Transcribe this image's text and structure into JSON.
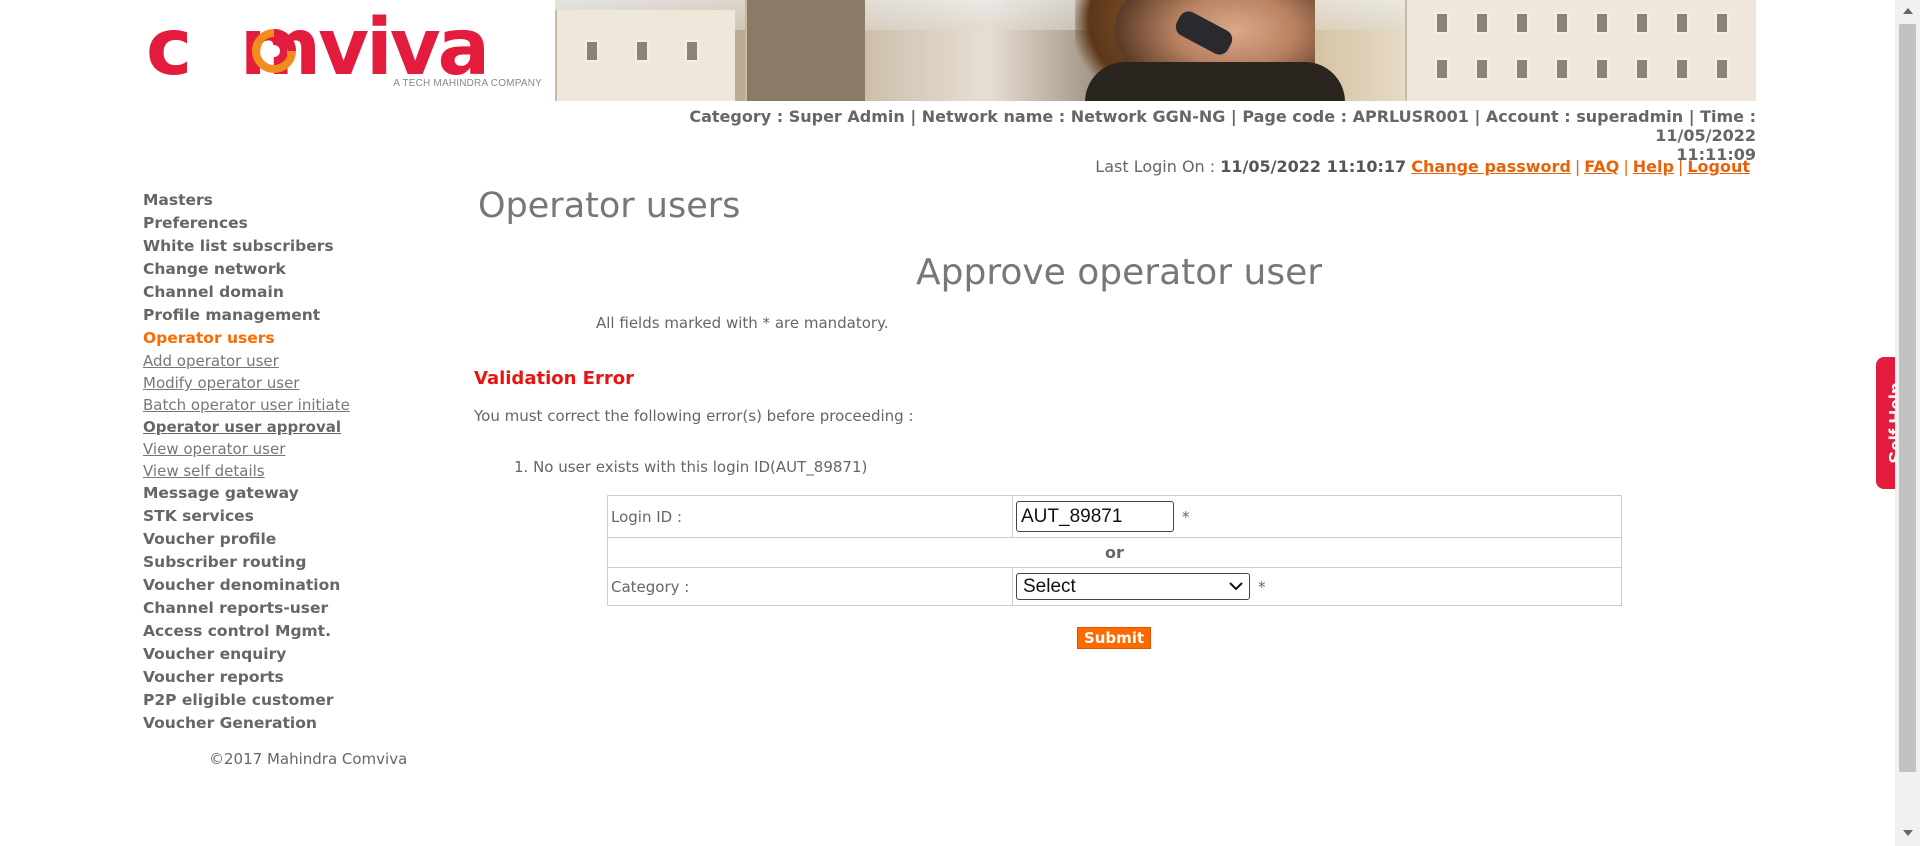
{
  "brand": {
    "name": "comviva",
    "tagline": "A TECH MAHINDRA COMPANY",
    "primary_color": "#e31b3c",
    "accent_color": "#ff6a00"
  },
  "info": {
    "line1": "Category : Super Admin | Network name : Network GGN-NG | Page code : APRLUSR001 | Account : superadmin | Time : 11/05/2022",
    "line2": "11:11:09"
  },
  "login": {
    "prefix": "Last Login On :",
    "timestamp": "11/05/2022 11:10:17",
    "change_password": "Change password",
    "faq": "FAQ",
    "help": "Help",
    "logout": "Logout"
  },
  "sidebar": {
    "items": [
      {
        "label": "Masters"
      },
      {
        "label": "Preferences"
      },
      {
        "label": "White list subscribers"
      },
      {
        "label": "Change network"
      },
      {
        "label": "Channel domain"
      },
      {
        "label": "Profile management"
      },
      {
        "label": "Operator users"
      },
      {
        "label": "Message gateway"
      },
      {
        "label": "STK services"
      },
      {
        "label": "Voucher profile"
      },
      {
        "label": "Subscriber routing"
      },
      {
        "label": "Voucher denomination"
      },
      {
        "label": "Channel reports-user"
      },
      {
        "label": "Access control Mgmt."
      },
      {
        "label": "Voucher enquiry"
      },
      {
        "label": "Voucher reports"
      },
      {
        "label": "P2P eligible customer"
      },
      {
        "label": "Voucher Generation"
      }
    ],
    "sub_items": [
      {
        "label": "Add operator user"
      },
      {
        "label": "Modify operator user"
      },
      {
        "label": "Batch operator user initiate"
      },
      {
        "label": "Operator user approval"
      },
      {
        "label": "View operator user"
      },
      {
        "label": "View self details"
      }
    ],
    "copyright": "©2017 Mahindra Comviva"
  },
  "main": {
    "page_title": "Operator users",
    "form_title": "Approve operator user",
    "mandatory_note": "All fields marked with * are mandatory.",
    "validation_title": "Validation Error",
    "validation_sub": "You must correct the following error(s) before proceeding :",
    "errors": [
      "1. No user exists with this login ID(AUT_89871)"
    ],
    "login_id_label": "Login ID :",
    "login_id_value": "AUT_89871",
    "or_label": "or",
    "category_label": "Category :",
    "category_value": "Select",
    "required_mark": "*",
    "submit_label": "Submit"
  },
  "self_help": {
    "label": "Self Help"
  }
}
